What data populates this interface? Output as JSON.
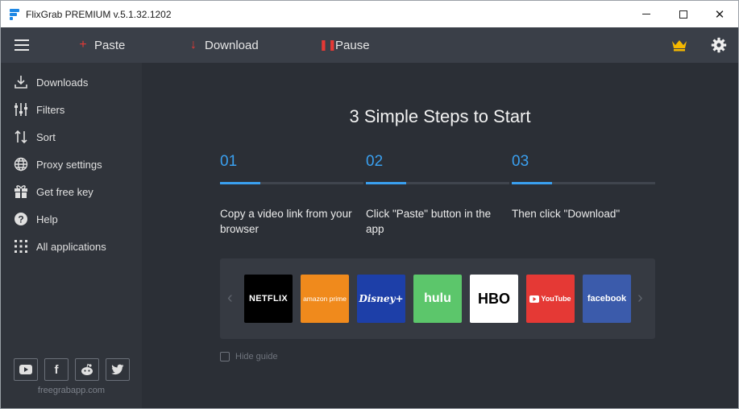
{
  "window": {
    "title": "FlixGrab PREMIUM  v.5.1.32.1202",
    "controls": {
      "minimize": "minimize",
      "maximize": "maximize",
      "close": "✕"
    }
  },
  "toolbar": {
    "paste": {
      "label": "Paste",
      "icon": "plus-icon"
    },
    "download": {
      "label": "Download",
      "icon": "arrow-down-icon"
    },
    "pause": {
      "label": "Pause",
      "icon": "pause-icon"
    },
    "premium_icon": "crown-icon",
    "settings_icon": "gear-icon"
  },
  "sidebar": {
    "items": [
      {
        "label": "Downloads",
        "icon": "download-icon"
      },
      {
        "label": "Filters",
        "icon": "sliders-icon"
      },
      {
        "label": "Sort",
        "icon": "sort-icon"
      },
      {
        "label": "Proxy settings",
        "icon": "globe-icon"
      },
      {
        "label": "Get free key",
        "icon": "gift-icon"
      },
      {
        "label": "Help",
        "icon": "help-icon"
      },
      {
        "label": "All applications",
        "icon": "grid-icon"
      }
    ],
    "social": [
      "youtube-icon",
      "facebook-icon",
      "reddit-icon",
      "twitter-icon"
    ],
    "site": "freegrabapp.com"
  },
  "guide": {
    "headline": "3 Simple Steps to Start",
    "steps": [
      {
        "num": "01",
        "text": "Copy a video link from your browser"
      },
      {
        "num": "02",
        "text": "Click \"Paste\" button in the app"
      },
      {
        "num": "03",
        "text": "Then click \"Download\""
      }
    ],
    "services": [
      {
        "label": "NETFLIX",
        "bg": "#000000",
        "fg": "#ffffff"
      },
      {
        "label": "amazon prime",
        "bg": "#f08a1c",
        "fg": "#ffffff"
      },
      {
        "label": "Disney+",
        "bg": "#1d3fa8",
        "fg": "#ffffff"
      },
      {
        "label": "hulu",
        "bg": "#5cc66b",
        "fg": "#ffffff"
      },
      {
        "label": "HBO",
        "bg": "#ffffff",
        "fg": "#000000"
      },
      {
        "label": "YouTube",
        "bg": "#e53935",
        "fg": "#ffffff"
      },
      {
        "label": "facebook",
        "bg": "#3b5bab",
        "fg": "#ffffff"
      }
    ],
    "hide_label": "Hide guide"
  },
  "colors": {
    "accent": "#3aa0f0",
    "toolbar_icon": "#e53935",
    "crown": "#f5b800"
  }
}
